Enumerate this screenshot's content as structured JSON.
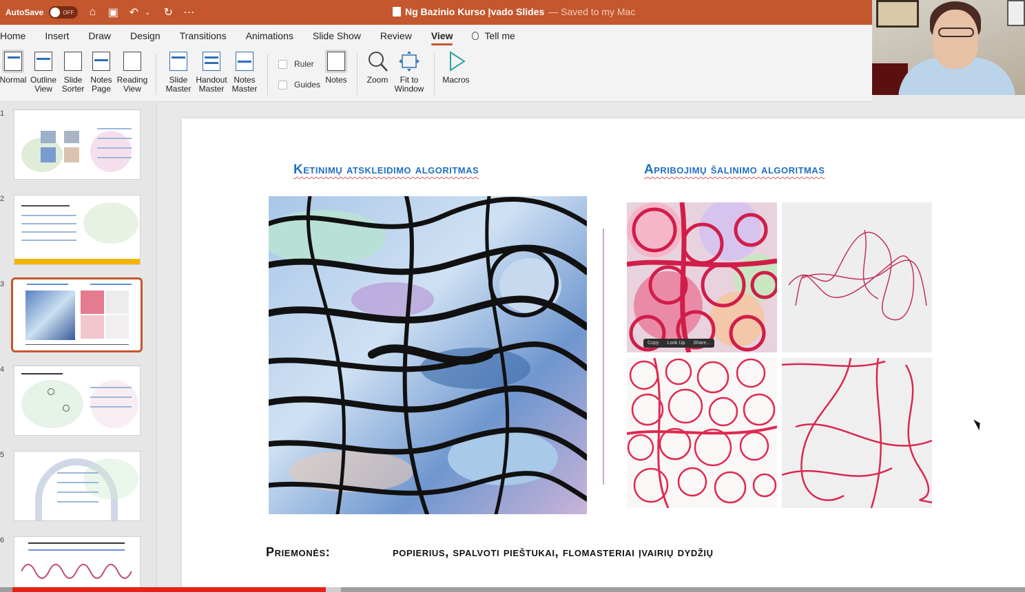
{
  "titlebar": {
    "autosave_label": "AutoSave",
    "autosave_state": "OFF",
    "doc_name": "Ng Bazinio Kurso Įvado Slides",
    "saved_status": "— Saved to my Mac",
    "icons": [
      "home-icon",
      "save-icon",
      "undo-icon",
      "redo-icon",
      "more-icon"
    ]
  },
  "menubar": {
    "tabs": [
      "Home",
      "Insert",
      "Draw",
      "Design",
      "Transitions",
      "Animations",
      "Slide Show",
      "Review",
      "View"
    ],
    "active_tab": "View",
    "tell_me": "Tell me"
  },
  "ribbon": {
    "normal": "Normal",
    "outline_view": "Outline View",
    "slide_sorter": "Slide Sorter",
    "notes_page": "Notes Page",
    "reading_view": "Reading View",
    "slide_master": "Slide Master",
    "handout_master": "Handout Master",
    "notes_master": "Notes Master",
    "ruler": "Ruler",
    "guides": "Guides",
    "notes": "Notes",
    "zoom": "Zoom",
    "fit_to_window": "Fit to Window",
    "macros": "Macros"
  },
  "thumbnails": {
    "numbers": [
      "1",
      "2",
      "3",
      "4",
      "5",
      "6"
    ],
    "active_index": 3
  },
  "slide": {
    "left_heading": "Ketinimų atskleidimo algoritmas",
    "right_heading": "Apribojimų šalinimo algoritmas",
    "tools_label": "Priemonės:",
    "tools_text": "popierius,  spalvoti pieštukai,  flomasteriai įvairių dydžių",
    "context_menu": [
      "Copy",
      "Look Up",
      "Share..."
    ]
  },
  "colors": {
    "accent": "#c4572e",
    "heading": "#1f6fc2",
    "video_progress": "#e62117"
  },
  "video": {
    "progress_fraction": 0.306
  }
}
